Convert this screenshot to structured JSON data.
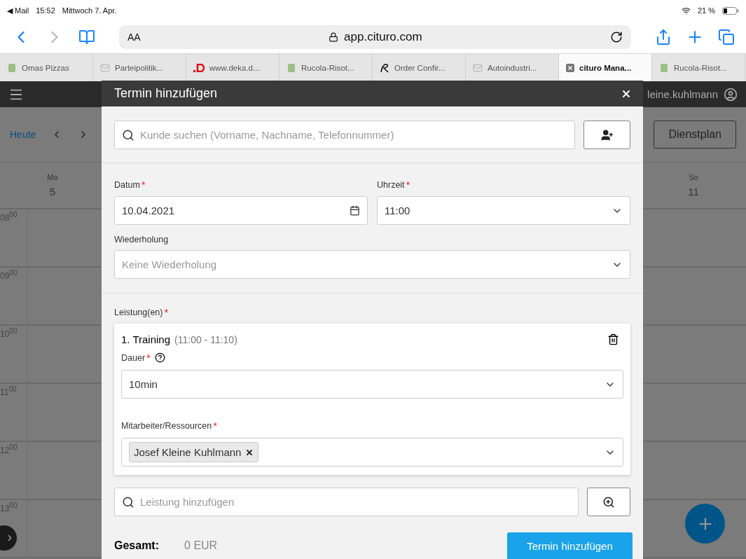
{
  "status_bar": {
    "back_app": "◀ Mail",
    "time": "15:52",
    "date": "Mittwoch 7. Apr.",
    "battery": "21 %"
  },
  "browser": {
    "text_size": "AA",
    "url": "app.cituro.com"
  },
  "tabs": [
    {
      "label": "Omas Pizzas",
      "kind": "site",
      "selected": false
    },
    {
      "label": "Parteipolitik...",
      "kind": "mail",
      "selected": false
    },
    {
      "label": "www.deka.d...",
      "kind": "deka",
      "selected": false
    },
    {
      "label": "Rucola-Risot...",
      "kind": "site",
      "selected": false
    },
    {
      "label": "Order Confir...",
      "kind": "logo",
      "selected": false
    },
    {
      "label": "Autoindustri...",
      "kind": "mail",
      "selected": false
    },
    {
      "label": "cituro Mana...",
      "kind": "close",
      "selected": true
    },
    {
      "label": "Rucola-Risot...",
      "kind": "site",
      "selected": false
    }
  ],
  "app": {
    "user": "leine.kuhlmann",
    "today": "Heute",
    "roster_button": "Dienstplan",
    "days": [
      {
        "weekday": "Mo",
        "day": "5"
      },
      {
        "weekday": "So",
        "day": "11"
      }
    ],
    "hours": [
      "08$^{00}$",
      "09$^{00}$",
      "10$^{00}$",
      "11$^{00}$",
      "12$^{00}$",
      "13$^{00}$"
    ]
  },
  "modal": {
    "title": "Termin hinzufügen",
    "customer_search": {
      "placeholder": "Kunde suchen (Vorname, Nachname, Telefonnummer)"
    },
    "date": {
      "label": "Datum",
      "required": "*",
      "value": "10.04.2021"
    },
    "time": {
      "label": "Uhrzeit",
      "required": "*",
      "value": "11:00"
    },
    "repeat": {
      "label": "Wiederholung",
      "placeholder": "Keine Wiederholung"
    },
    "services_label": {
      "label": "Leistung(en)",
      "required": "*"
    },
    "service": {
      "title": "1. Training",
      "time": "(11:00 - 11:10)",
      "duration": {
        "label": "Dauer",
        "required": "*",
        "value": "10min"
      },
      "staff": {
        "label": "Mitarbeiter/Ressourcen",
        "required": "*",
        "tags": [
          "Josef Kleine Kuhlmann"
        ]
      }
    },
    "add_service": {
      "placeholder": "Leistung hinzufügen"
    },
    "total_label": "Gesamt:",
    "total": "0 EUR",
    "submit": "Termin hinzufügen"
  }
}
